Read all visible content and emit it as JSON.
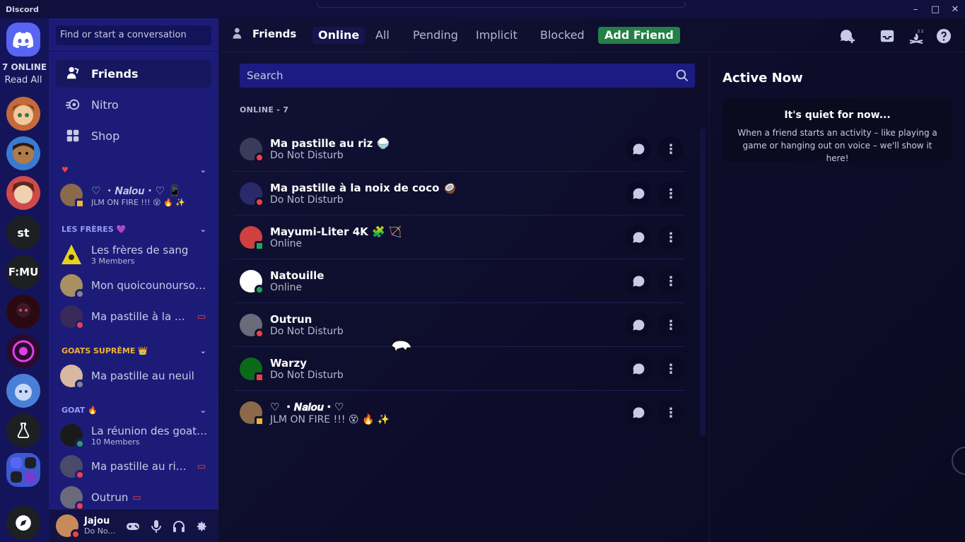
{
  "window": {
    "app_name": "Discord",
    "controls": [
      "minimize",
      "maximize",
      "close"
    ]
  },
  "rail": {
    "online_label": "7 ONLINE",
    "read_all": "Read All",
    "servers": [
      {
        "name": "avatar-server",
        "label": "",
        "color": "#c46a3a"
      },
      {
        "name": "avatar-server",
        "label": "",
        "color": "#3a7bd0"
      },
      {
        "name": "avatar-server",
        "label": "",
        "color": "#d04a4a"
      },
      {
        "name": "text-server",
        "label": "st",
        "color": "#1e1f22"
      },
      {
        "name": "text-server",
        "label": "F:MU",
        "color": "#1e1f22"
      },
      {
        "name": "avatar-server",
        "label": "",
        "color": "#5a1a2a"
      },
      {
        "name": "avatar-server",
        "label": "",
        "color": "#2a0a30"
      },
      {
        "name": "avatar-server",
        "label": "",
        "color": "#4a7fd8"
      },
      {
        "name": "avatar-server",
        "label": "",
        "color": "#1e1f22"
      }
    ]
  },
  "sidebar": {
    "search_placeholder": "Find or start a conversation",
    "nav": [
      {
        "label": "Friends",
        "icon": "friends-icon"
      },
      {
        "label": "Nitro",
        "icon": "nitro-icon"
      },
      {
        "label": "Shop",
        "icon": "shop-icon"
      }
    ],
    "categories": [
      {
        "label": "♥",
        "color": "#f23f43"
      },
      {
        "label": "LES FRÈRES 💜",
        "color": "#949cf7"
      },
      {
        "label": "GOATS SUPRÊME 👑",
        "color": "#f0b232"
      },
      {
        "label": "GOAT 🔥",
        "color": "#949cf7"
      }
    ],
    "dms": [
      {
        "name": "♡ ・𝑵𝒂𝒍𝒐𝒖・♡ 📱",
        "sub": "JLM ON FIRE !!! 😵 🔥 ✨",
        "status": "idle"
      },
      {
        "name": "Les frères de sang",
        "sub": "3 Members",
        "status": ""
      },
      {
        "name": "Mon quoicounourson ...",
        "sub": "",
        "status": "idle"
      },
      {
        "name": "Ma pastille à la n...",
        "sub": "",
        "status": "dnd"
      },
      {
        "name": "Ma pastille au neuil",
        "sub": "",
        "status": "idle"
      },
      {
        "name": "La réunion des goats...",
        "sub": "10 Members",
        "status": "onl"
      },
      {
        "name": "Ma pastille au riz...",
        "sub": "",
        "status": "dnd"
      },
      {
        "name": "Outrun",
        "sub": "",
        "status": "dnd"
      }
    ],
    "user": {
      "name": "Jajou",
      "status": "Do No..."
    }
  },
  "header": {
    "title": "Friends",
    "tabs": [
      "Online",
      "All",
      "Pending",
      "Implicit",
      "Blocked"
    ],
    "add_friend": "Add Friend"
  },
  "friends": {
    "search_placeholder": "Search",
    "online_count": "ONLINE - 7",
    "list": [
      {
        "name": "Ma pastille au riz 🍚",
        "status": "Do Not Disturb",
        "state": "dnd"
      },
      {
        "name": "Ma pastille à la noix de coco 🥥",
        "status": "Do Not Disturb",
        "state": "dnd"
      },
      {
        "name": "Mayumi-Liter 4K 🧩 🏹",
        "status": "Online",
        "state": "onl"
      },
      {
        "name": "Natouille",
        "status": "Online",
        "state": "onl"
      },
      {
        "name": "Outrun",
        "status": "Do Not Disturb",
        "state": "dnd"
      },
      {
        "name": "Warzy",
        "status": "Do Not Disturb",
        "state": "dnd"
      },
      {
        "name": "♡ ・𝑵𝒂𝒍𝒐𝒖・♡",
        "status": "JLM ON FIRE !!! 😵 🔥 ✨",
        "state": "idle"
      }
    ]
  },
  "active_now": {
    "title": "Active Now",
    "quiet_title": "It's quiet for now...",
    "quiet_desc": "When a friend starts an activity – like playing a game or hanging out on voice – we'll show it here!"
  }
}
